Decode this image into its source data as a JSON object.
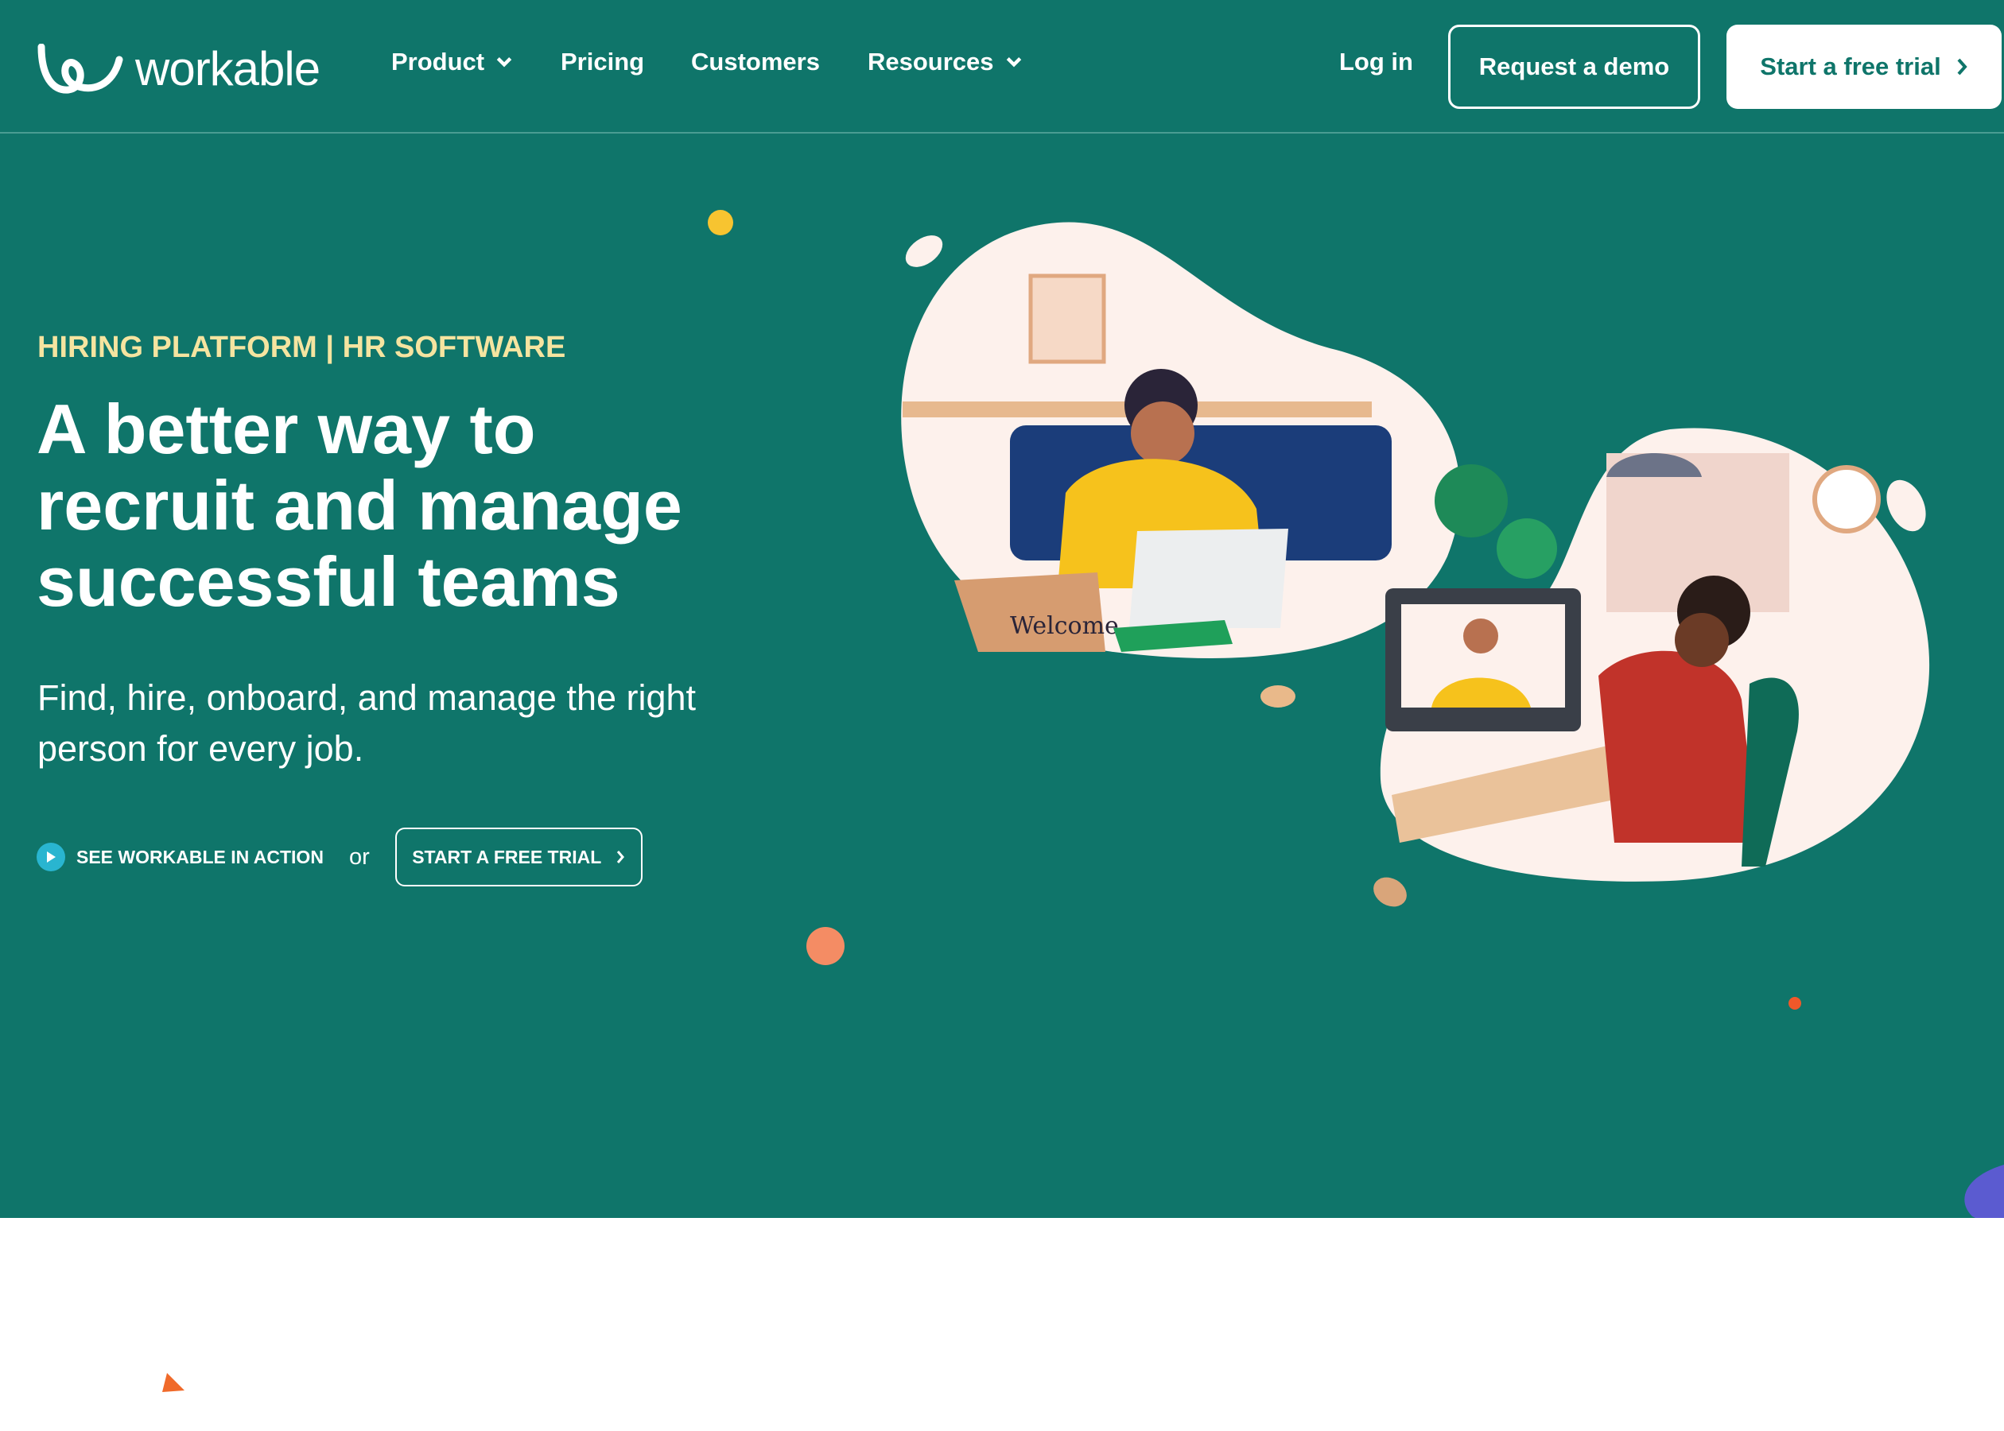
{
  "brand": {
    "name": "workable",
    "color": "#0f756a",
    "accent_yellow": "#f5e4a0"
  },
  "nav": {
    "items": [
      {
        "label": "Product",
        "has_dropdown": true
      },
      {
        "label": "Pricing",
        "has_dropdown": false
      },
      {
        "label": "Customers",
        "has_dropdown": false
      },
      {
        "label": "Resources",
        "has_dropdown": true
      }
    ],
    "login": "Log in",
    "demo": "Request a demo",
    "trial": "Start a free trial"
  },
  "hero": {
    "eyebrow": "HIRING PLATFORM | HR SOFTWARE",
    "title_lines": [
      "A better way to",
      "recruit and manage",
      "successful teams"
    ],
    "subtitle": "Find, hire, onboard, and manage the right person for every job.",
    "see_action": "SEE WORKABLE IN ACTION",
    "or": "or",
    "trial": "START A FREE TRIAL",
    "illustration_text": "Welcome"
  }
}
